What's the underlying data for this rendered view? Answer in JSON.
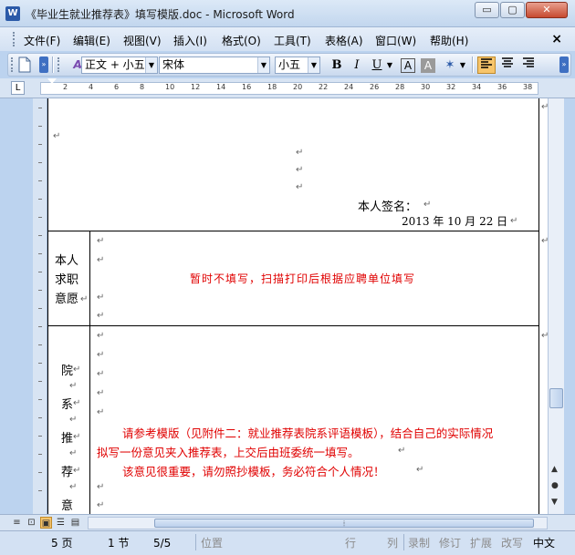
{
  "window": {
    "title": "《毕业生就业推荐表》填写模版.doc - Microsoft Word",
    "app_icon": "W",
    "minimize_label": "▭",
    "restore_label": "▢",
    "close_label": "✕"
  },
  "menu": {
    "items": [
      "文件(F)",
      "编辑(E)",
      "视图(V)",
      "插入(I)",
      "格式(O)",
      "工具(T)",
      "表格(A)",
      "窗口(W)",
      "帮助(H)"
    ],
    "doc_close": "×"
  },
  "toolbar": {
    "style_value": "正文 + 小五",
    "font_value": "宋体",
    "size_value": "小五",
    "bold": "B",
    "italic": "I",
    "underline": "U",
    "char_border": "A",
    "char_shading": "A",
    "highlight": "✶"
  },
  "ruler": {
    "tab_selector": "L",
    "ticks": [
      "2",
      "4",
      "6",
      "8",
      "10",
      "12",
      "14",
      "16",
      "18",
      "20",
      "22",
      "24",
      "26",
      "28",
      "30",
      "32",
      "34",
      "36",
      "38"
    ]
  },
  "document": {
    "para_mark": "↵",
    "signature_label": "本人签名：",
    "signature_date": "2013 年  10 月 22 日",
    "wish_label": [
      "本人",
      "求职",
      "意愿"
    ],
    "wish_note": "暂时不填写，扫描打印后根据应聘单位填写",
    "college_label": [
      "院",
      "系",
      "推",
      "荐",
      "意"
    ],
    "college_note_line1": "请参考模版（见附件二：就业推荐表院系评语模板），结合自己的实际情况",
    "college_note_line2": "拟写一份意见夹入推荐表，上交后由班委统一填写。",
    "college_note_line3": "该意见很重要，请勿照抄模板，务必符合个人情况！"
  },
  "statusbar": {
    "page": "5 页",
    "section": "1 节",
    "page_of": "5/5",
    "position": "位置",
    "line": "行",
    "column": "列",
    "rec": "录制",
    "trk": "修订",
    "ext": "扩展",
    "ovr": "改写",
    "lang": "中文"
  },
  "colors": {
    "red_text": "#e00000",
    "chrome": "#d3e1f3"
  }
}
